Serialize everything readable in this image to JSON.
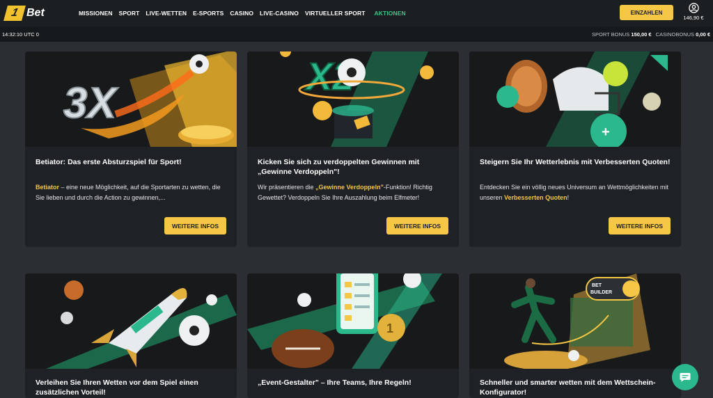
{
  "header": {
    "logo_mark": "1",
    "logo_text": "Bet",
    "nav": [
      "MISSIONEN",
      "SPORT",
      "LIVE-WETTEN",
      "E-SPORTS",
      "CASINO",
      "LIVE-CASINO",
      "VIRTUELLER SPORT"
    ],
    "nav_active": "AKTIONEN",
    "deposit_label": "EINZAHLEN",
    "balance": "146,90 €",
    "account_icon": "user-circle-icon"
  },
  "statusbar": {
    "clock": "14:32:10 UTC 0",
    "sport_bonus_label": "SPORT BONUS",
    "sport_bonus_value": "150,00 €",
    "casino_bonus_label": "CASINOBONUS",
    "casino_bonus_value": "0,00 €"
  },
  "cards": [
    {
      "title": "Betiator: Das erste Absturzspiel für Sport!",
      "desc_hl": "Betiator",
      "desc_rest": " – eine neue Möglichkeit, auf die Sportarten zu wetten, die Sie lieben und durch die Action zu gewinnen,...",
      "button": "WEITERE INFOS"
    },
    {
      "title": "Kicken Sie sich zu verdoppelten Gewinnen mit „Gewinne Verdoppeln\"!",
      "desc_pre": "Wir präsentieren die ",
      "desc_hl": "„Gewinne Verdoppeln\"",
      "desc_rest": "-Funktion! Richtig Gewettet? Verdoppeln Sie Ihre Auszahlung beim Elfmeter!",
      "button": "WEITERE INFOS"
    },
    {
      "title": "Steigern Sie Ihr Wetterlebnis mit Verbesserten Quoten!",
      "desc_pre": "Entdecken Sie ein völlig neues Universum an Wettmöglichkeiten mit unseren ",
      "desc_hl": "Verbesserten Quoten",
      "desc_rest": "!",
      "button": "WEITERE INFOS"
    },
    {
      "title": "Verleihen Sie Ihren Wetten vor dem Spiel einen zusätzlichen Vorteil!"
    },
    {
      "title": "„Event-Gestalter\" – Ihre Teams, Ihre Regeln!"
    },
    {
      "title": "Schneller und smarter wetten mit dem Wettschein-Konfigurator!",
      "badge": "BET BUILDER"
    }
  ],
  "colors": {
    "accent": "#f6c744",
    "active_nav": "#39c68a",
    "green": "#2bb88d",
    "card_bg": "#1e2226"
  }
}
